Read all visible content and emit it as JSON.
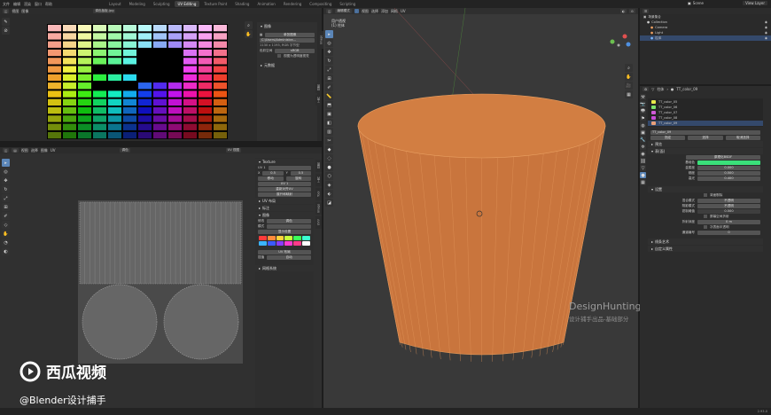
{
  "menu": [
    "文件",
    "编辑",
    "渲染",
    "窗口",
    "帮助"
  ],
  "workspaces": [
    "Layout",
    "Modeling",
    "Sculpting",
    "UV Editing",
    "Texture Paint",
    "Shading",
    "Animation",
    "Rendering",
    "Compositing",
    "Scripting"
  ],
  "active_workspace_index": 3,
  "scene": {
    "label": "Scene",
    "view_layer": "View Layer"
  },
  "image_editor": {
    "menus": [
      "视图",
      "图像"
    ],
    "image_name": "调色板板.jpg",
    "panel_title": "图像",
    "source_label": "单张图像",
    "path": "C:\\Users\\Administra...",
    "info": "1130 x 1193, RGB 字节型",
    "colorspace_label": "色彩空间",
    "colorspace": "sRGB",
    "checkbox": "视图为透明度视觉",
    "metadata": "元数据"
  },
  "uv_editor": {
    "menus": [
      "视图",
      "选择",
      "图像",
      "UV"
    ],
    "header_view": "UV 视图",
    "image_label": "调色",
    "panel_title": "Texture",
    "uv_vertex_label": "UV 1",
    "x_label": "X",
    "y_label": "Y",
    "x_value": "0.5",
    "y_value": "0.5",
    "move_label": "移动",
    "rotate_label": "旋转",
    "uv_header": "UV 1",
    "btn_uv_a": "重新对齐UV",
    "btn_uv_b": "展开和映射",
    "tabs": [
      "UV 布局",
      "标注",
      "图像"
    ],
    "color_label": "修改",
    "palette_label": "模式",
    "palette_name": "调色",
    "section_a": "显示设置",
    "section_b": "UV 布局",
    "extra_label": "插值",
    "extra_value": "自动",
    "grid_label": "网格系统",
    "vtabs": [
      "视图",
      "工具",
      "Tool",
      "Image",
      "UVV"
    ]
  },
  "viewport": {
    "menus": [
      "视图",
      "选择",
      "添加",
      "网格",
      "UV"
    ],
    "mode": "编辑模式",
    "overlay_title": "用户透视",
    "overlay_sub": "(1) 柱体",
    "vtabs": [
      "视图",
      "工具",
      "Tool",
      "Item",
      "UVV",
      "View"
    ],
    "watermark_title": "DesignHunting",
    "watermark_sub": "设计捕手出品-基础部分"
  },
  "outliner": {
    "title": "场景集合",
    "items": [
      {
        "name": "Collection",
        "color": "#cfcfcf"
      },
      {
        "name": "Camera",
        "color": "#f0a060"
      },
      {
        "name": "Light",
        "color": "#f0a060"
      },
      {
        "name": "柱体",
        "color": "#7cb8ff"
      }
    ]
  },
  "properties": {
    "breadcrumb_obj": "柱体",
    "breadcrumb_mat": "TT_color_09",
    "materials": [
      {
        "name": "TT_color_05",
        "color": "#e8e84a"
      },
      {
        "name": "TT_color_06",
        "color": "#7de36c"
      },
      {
        "name": "TT_color_07",
        "color": "#d05ad6"
      },
      {
        "name": "TT_color_08",
        "color": "#c84ad8"
      },
      {
        "name": "TT_color_09",
        "color": "#e8a07a"
      }
    ],
    "material_field": "TT_color_09",
    "assign_buttons": [
      "指定",
      "选择",
      "取消选择"
    ],
    "preview": "预览",
    "surface": "表(面)",
    "surface_type": "原理化BSDF",
    "rows": [
      {
        "label": "基础色",
        "value": "",
        "color": "#3ae07a"
      },
      {
        "label": "金属度",
        "value": "0.000"
      },
      {
        "label": "糙度",
        "value": "0.500"
      },
      {
        "label": "高光",
        "value": "0.400"
      }
    ],
    "settings": "设置",
    "backface": "背面剔除",
    "blend_label": "混合模式",
    "blend_value": "不透明",
    "shadow_label": "阴影模式",
    "shadow_value": "不透明",
    "clip_label": "钳制阈值",
    "clip_value": "0.500",
    "screen_refraction": "屏幕空间折射",
    "refraction_depth_label": "折射深度",
    "refraction_depth": "0 m",
    "subsurface_trans": "次表面半透明",
    "pass_index_label": "通道编号",
    "pass_index": "0",
    "line_art": "线条艺术",
    "custom_props": "自定义属性"
  },
  "overlay_brand": {
    "name": "西瓜视频",
    "handle": "@Blender设计捕手"
  },
  "status_bar": {
    "version": "2.93.0"
  },
  "palette_colors": [
    "#ff3b3b",
    "#ff8a3b",
    "#ffd23b",
    "#c8ff3b",
    "#3bff5a",
    "#3bffd2",
    "#3bb4ff",
    "#3b5aff",
    "#8a3bff",
    "#ff3bd2",
    "#ff3b8a",
    "#ffffff"
  ]
}
